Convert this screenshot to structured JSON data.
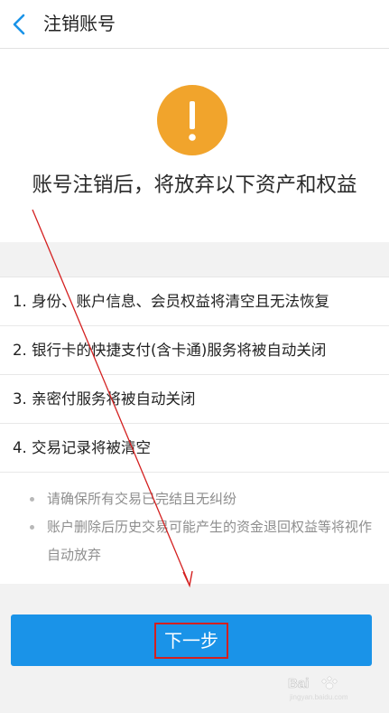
{
  "header": {
    "title": "注销账号",
    "back_icon": "chevron-left-icon"
  },
  "hero": {
    "icon": "exclamation-icon",
    "icon_color": "#f1a42c",
    "title": "账号注销后，将放弃以下资产和权益"
  },
  "items": [
    {
      "text": "1. 身份、账户信息、会员权益将清空且无法恢复"
    },
    {
      "text": "2. 银行卡的快捷支付(含卡通)服务将被自动关闭"
    },
    {
      "text": "3. 亲密付服务将被自动关闭"
    },
    {
      "text": "4. 交易记录将被清空"
    }
  ],
  "notes": [
    {
      "text": "请确保所有交易已完结且无纠纷"
    },
    {
      "text": "账户删除后历史交易可能产生的资金退回权益等将视作自动放弃"
    }
  ],
  "footer": {
    "next_label": "下一步",
    "button_color": "#1a93e8",
    "annotation_color": "#d42020"
  },
  "watermark": {
    "logo": "Bai",
    "site": "jingyan.baidu.com"
  }
}
